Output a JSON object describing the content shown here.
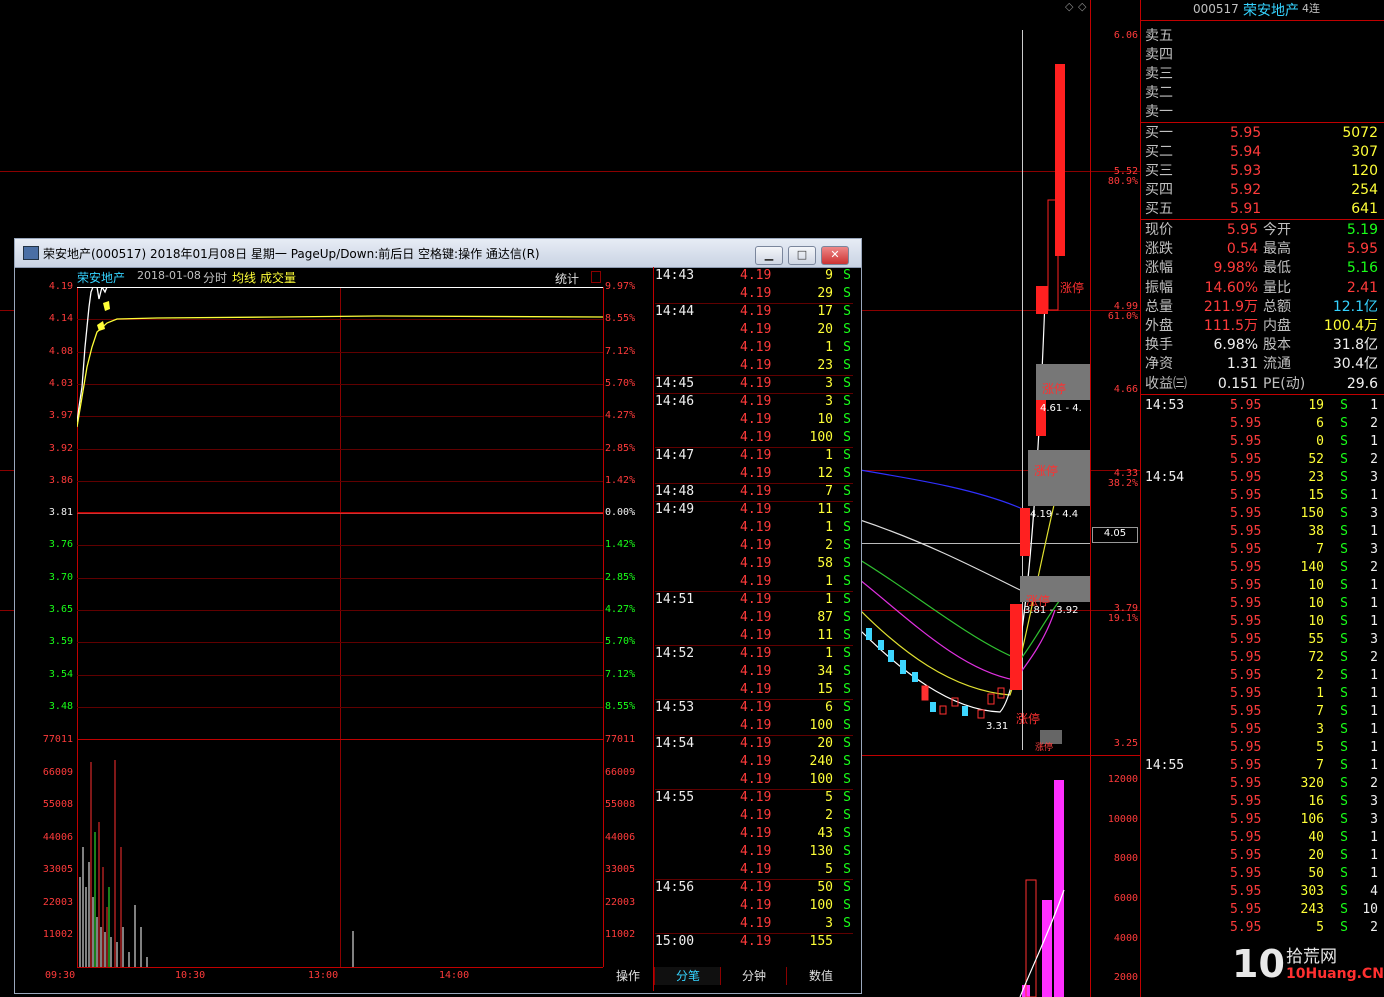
{
  "header": {
    "code": "000517",
    "name": "荣安地产",
    "name_suffix": "4连"
  },
  "right_axis": {
    "prices": [
      "6.06",
      "5.52",
      "4.99",
      "4.66",
      "4.33",
      "3.79",
      "3.25"
    ],
    "percents": [
      "80.9%",
      "61.0%",
      "38.2%",
      "19.1%"
    ],
    "volume_ticks": [
      "12000",
      "10000",
      "8000",
      "6000",
      "4000",
      "2000"
    ],
    "current_line": "4.05"
  },
  "kline_labels": {
    "l1": "涨停",
    "l2": "涨停",
    "l3": "涨停",
    "l4": "涨停",
    "l5": "涨停",
    "l6": "涨停",
    "range1": "4.61 - 4.",
    "range2": "4.19 - 4.4",
    "range3": "3.81 - 3.92",
    "low": "3.31",
    "tag": "涨停"
  },
  "order_book": {
    "asks": [
      {
        "label": "卖五"
      },
      {
        "label": "卖四"
      },
      {
        "label": "卖三"
      },
      {
        "label": "卖二"
      },
      {
        "label": "卖一"
      }
    ],
    "bids": [
      {
        "label": "买一",
        "price": "5.95",
        "vol": "5072"
      },
      {
        "label": "买二",
        "price": "5.94",
        "vol": "307"
      },
      {
        "label": "买三",
        "price": "5.93",
        "vol": "120"
      },
      {
        "label": "买四",
        "price": "5.92",
        "vol": "254"
      },
      {
        "label": "买五",
        "price": "5.91",
        "vol": "641"
      }
    ]
  },
  "quote": {
    "rows": [
      {
        "k1": "现价",
        "v1": "5.95",
        "k2": "今开",
        "v2": "5.19"
      },
      {
        "k1": "涨跌",
        "v1": "0.54",
        "k2": "最高",
        "v2": "5.95"
      },
      {
        "k1": "涨幅",
        "v1": "9.98%",
        "k2": "最低",
        "v2": "5.16"
      },
      {
        "k1": "振幅",
        "v1": "14.60%",
        "k2": "量比",
        "v2": "2.41"
      },
      {
        "k1": "总量",
        "v1": "211.9万",
        "k2": "总额",
        "v2": "12.1亿"
      },
      {
        "k1": "外盘",
        "v1": "111.5万",
        "k2": "内盘",
        "v2": "100.4万"
      },
      {
        "k1": "换手",
        "v1": "6.98%",
        "k2": "股本",
        "v2": "31.8亿"
      },
      {
        "k1": "净资",
        "v1": "1.31",
        "k2": "流通",
        "v2": "30.4亿"
      },
      {
        "k1": "收益㈢",
        "v1": "0.151",
        "k2": "PE(动)",
        "v2": "29.6"
      }
    ]
  },
  "right_ticks": [
    {
      "time": "14:53",
      "price": "5.95",
      "vol": "19",
      "bs": "S",
      "n": "1"
    },
    {
      "time": "",
      "price": "5.95",
      "vol": "6",
      "bs": "S",
      "n": "2"
    },
    {
      "time": "",
      "price": "5.95",
      "vol": "0",
      "bs": "S",
      "n": "1"
    },
    {
      "time": "",
      "price": "5.95",
      "vol": "52",
      "bs": "S",
      "n": "2"
    },
    {
      "time": "14:54",
      "price": "5.95",
      "vol": "23",
      "bs": "S",
      "n": "3"
    },
    {
      "time": "",
      "price": "5.95",
      "vol": "15",
      "bs": "S",
      "n": "1"
    },
    {
      "time": "",
      "price": "5.95",
      "vol": "150",
      "bs": "S",
      "n": "3"
    },
    {
      "time": "",
      "price": "5.95",
      "vol": "38",
      "bs": "S",
      "n": "1"
    },
    {
      "time": "",
      "price": "5.95",
      "vol": "7",
      "bs": "S",
      "n": "3"
    },
    {
      "time": "",
      "price": "5.95",
      "vol": "140",
      "bs": "S",
      "n": "2"
    },
    {
      "time": "",
      "price": "5.95",
      "vol": "10",
      "bs": "S",
      "n": "1"
    },
    {
      "time": "",
      "price": "5.95",
      "vol": "10",
      "bs": "S",
      "n": "1"
    },
    {
      "time": "",
      "price": "5.95",
      "vol": "10",
      "bs": "S",
      "n": "1"
    },
    {
      "time": "",
      "price": "5.95",
      "vol": "55",
      "bs": "S",
      "n": "3"
    },
    {
      "time": "",
      "price": "5.95",
      "vol": "72",
      "bs": "S",
      "n": "2"
    },
    {
      "time": "",
      "price": "5.95",
      "vol": "2",
      "bs": "S",
      "n": "1"
    },
    {
      "time": "",
      "price": "5.95",
      "vol": "1",
      "bs": "S",
      "n": "1"
    },
    {
      "time": "",
      "price": "5.95",
      "vol": "7",
      "bs": "S",
      "n": "1"
    },
    {
      "time": "",
      "price": "5.95",
      "vol": "3",
      "bs": "S",
      "n": "1"
    },
    {
      "time": "",
      "price": "5.95",
      "vol": "5",
      "bs": "S",
      "n": "1"
    },
    {
      "time": "14:55",
      "price": "5.95",
      "vol": "7",
      "bs": "S",
      "n": "1"
    },
    {
      "time": "",
      "price": "5.95",
      "vol": "320",
      "bs": "S",
      "n": "2"
    },
    {
      "time": "",
      "price": "5.95",
      "vol": "16",
      "bs": "S",
      "n": "3"
    },
    {
      "time": "",
      "price": "5.95",
      "vol": "106",
      "bs": "S",
      "n": "3"
    },
    {
      "time": "",
      "price": "5.95",
      "vol": "40",
      "bs": "S",
      "n": "1"
    },
    {
      "time": "",
      "price": "5.95",
      "vol": "20",
      "bs": "S",
      "n": "1"
    },
    {
      "time": "",
      "price": "5.95",
      "vol": "50",
      "bs": "S",
      "n": "1"
    },
    {
      "time": "",
      "price": "5.95",
      "vol": "303",
      "bs": "S",
      "n": "4"
    },
    {
      "time": "",
      "price": "5.95",
      "vol": "243",
      "bs": "S",
      "n": "10"
    },
    {
      "time": "",
      "price": "5.95",
      "vol": "5",
      "bs": "S",
      "n": "2"
    }
  ],
  "popup": {
    "title": "荣安地产(000517) 2018年01月08日 星期一 PageUp/Down:前后日 空格键:操作 通达信(R)",
    "chart_header": {
      "name": "荣安地产",
      "date": "2018-01-08",
      "type": "分时",
      "ma": "均线",
      "vol": "成交量",
      "stat": "统计"
    },
    "price_ticks": [
      "4.19",
      "4.14",
      "4.08",
      "4.03",
      "3.97",
      "3.92",
      "3.86",
      "3.81",
      "3.76",
      "3.70",
      "3.65",
      "3.59",
      "3.54",
      "3.48"
    ],
    "pct_ticks": [
      "9.97%",
      "8.55%",
      "7.12%",
      "5.70%",
      "4.27%",
      "2.85%",
      "1.42%",
      "0.00%",
      "1.42%",
      "2.85%",
      "4.27%",
      "5.70%",
      "7.12%",
      "8.55%"
    ],
    "vol_ticks": [
      "77011",
      "66009",
      "55008",
      "44006",
      "33005",
      "22003",
      "11002"
    ],
    "time_ticks": [
      "09:30",
      "10:30",
      "13:00",
      "14:00"
    ],
    "ticks": [
      {
        "time": "14:43",
        "price": "4.19",
        "vol": "9",
        "bs": "S"
      },
      {
        "time": "",
        "price": "4.19",
        "vol": "29",
        "bs": "S"
      },
      {
        "time": "14:44",
        "price": "4.19",
        "vol": "17",
        "bs": "S"
      },
      {
        "time": "",
        "price": "4.19",
        "vol": "20",
        "bs": "S"
      },
      {
        "time": "",
        "price": "4.19",
        "vol": "1",
        "bs": "S"
      },
      {
        "time": "",
        "price": "4.19",
        "vol": "23",
        "bs": "S"
      },
      {
        "time": "14:45",
        "price": "4.19",
        "vol": "3",
        "bs": "S"
      },
      {
        "time": "14:46",
        "price": "4.19",
        "vol": "3",
        "bs": "S"
      },
      {
        "time": "",
        "price": "4.19",
        "vol": "10",
        "bs": "S"
      },
      {
        "time": "",
        "price": "4.19",
        "vol": "100",
        "bs": "S"
      },
      {
        "time": "14:47",
        "price": "4.19",
        "vol": "1",
        "bs": "S"
      },
      {
        "time": "",
        "price": "4.19",
        "vol": "12",
        "bs": "S"
      },
      {
        "time": "14:48",
        "price": "4.19",
        "vol": "7",
        "bs": "S"
      },
      {
        "time": "14:49",
        "price": "4.19",
        "vol": "11",
        "bs": "S"
      },
      {
        "time": "",
        "price": "4.19",
        "vol": "1",
        "bs": "S"
      },
      {
        "time": "",
        "price": "4.19",
        "vol": "2",
        "bs": "S"
      },
      {
        "time": "",
        "price": "4.19",
        "vol": "58",
        "bs": "S"
      },
      {
        "time": "",
        "price": "4.19",
        "vol": "1",
        "bs": "S"
      },
      {
        "time": "14:51",
        "price": "4.19",
        "vol": "1",
        "bs": "S"
      },
      {
        "time": "",
        "price": "4.19",
        "vol": "87",
        "bs": "S"
      },
      {
        "time": "",
        "price": "4.19",
        "vol": "11",
        "bs": "S"
      },
      {
        "time": "14:52",
        "price": "4.19",
        "vol": "1",
        "bs": "S"
      },
      {
        "time": "",
        "price": "4.19",
        "vol": "34",
        "bs": "S"
      },
      {
        "time": "",
        "price": "4.19",
        "vol": "15",
        "bs": "S"
      },
      {
        "time": "14:53",
        "price": "4.19",
        "vol": "6",
        "bs": "S"
      },
      {
        "time": "",
        "price": "4.19",
        "vol": "100",
        "bs": "S"
      },
      {
        "time": "14:54",
        "price": "4.19",
        "vol": "20",
        "bs": "S"
      },
      {
        "time": "",
        "price": "4.19",
        "vol": "240",
        "bs": "S"
      },
      {
        "time": "",
        "price": "4.19",
        "vol": "100",
        "bs": "S"
      },
      {
        "time": "14:55",
        "price": "4.19",
        "vol": "5",
        "bs": "S"
      },
      {
        "time": "",
        "price": "4.19",
        "vol": "2",
        "bs": "S"
      },
      {
        "time": "",
        "price": "4.19",
        "vol": "43",
        "bs": "S"
      },
      {
        "time": "",
        "price": "4.19",
        "vol": "130",
        "bs": "S"
      },
      {
        "time": "",
        "price": "4.19",
        "vol": "5",
        "bs": "S"
      },
      {
        "time": "14:56",
        "price": "4.19",
        "vol": "50",
        "bs": "S"
      },
      {
        "time": "",
        "price": "4.19",
        "vol": "100",
        "bs": "S"
      },
      {
        "time": "",
        "price": "4.19",
        "vol": "3",
        "bs": "S"
      },
      {
        "time": "15:00",
        "price": "4.19",
        "vol": "155",
        "bs": ""
      }
    ],
    "bottom_tabs": [
      "操作",
      "分笔",
      "分钟",
      "数值"
    ]
  },
  "watermark": {
    "brand": "拾荒网",
    "url": "10Huang.CN"
  }
}
